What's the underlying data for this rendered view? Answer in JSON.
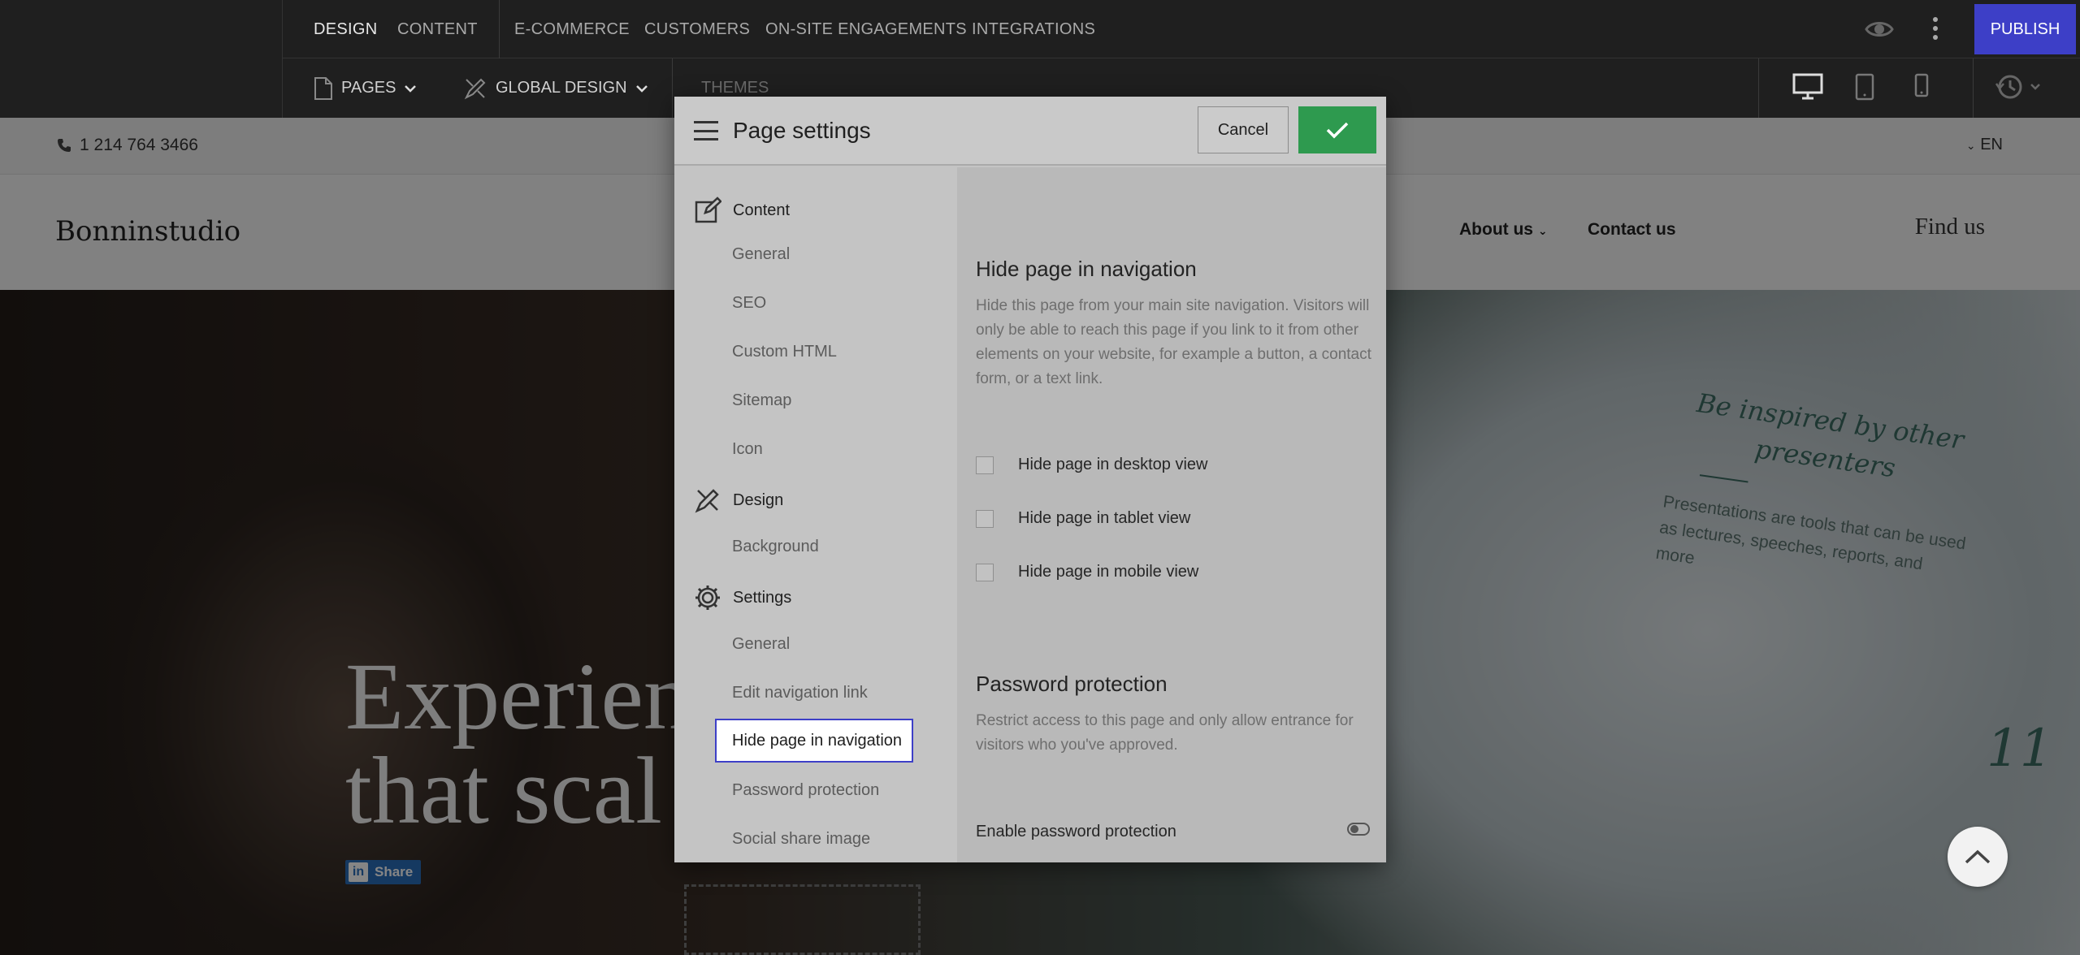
{
  "editor": {
    "tabs": [
      "DESIGN",
      "CONTENT",
      "E-COMMERCE",
      "CUSTOMERS",
      "ON-SITE ENGAGEMENTS",
      "INTEGRATIONS"
    ],
    "publish_label": "PUBLISH",
    "pages_label": "PAGES",
    "global_design_label": "GLOBAL DESIGN",
    "themes_label": "THEMES"
  },
  "site": {
    "phone": "1 214 764 3466",
    "language": "EN",
    "logo": "Bonninstudio",
    "nav": [
      "About us",
      "Contact us"
    ],
    "find_us": "Find us",
    "hero_line1": "Experien",
    "hero_line2": "that scal",
    "share_label": "Share",
    "promo_title": "Be inspired by other presenters",
    "promo_body": "Presentations are tools that can be used as lectures, speeches, reports, and more",
    "promo_number": "11"
  },
  "dialog": {
    "title": "Page settings",
    "cancel_label": "Cancel",
    "sidebar": {
      "content": {
        "label": "Content",
        "items": [
          "General",
          "SEO",
          "Custom HTML",
          "Sitemap",
          "Icon"
        ]
      },
      "design": {
        "label": "Design",
        "items": [
          "Background"
        ]
      },
      "settings": {
        "label": "Settings",
        "items": [
          "General",
          "Edit navigation link",
          "Hide page in navigation",
          "Password protection",
          "Social share image"
        ]
      }
    },
    "hide_nav": {
      "heading": "Hide page in navigation",
      "description": "Hide this page from your main site navigation. Visitors will only be able to reach this page if you link to it from other elements on your website, for example a button, a contact form, or a text link.",
      "options": [
        "Hide page in desktop view",
        "Hide page in tablet view",
        "Hide page in mobile view"
      ]
    },
    "password": {
      "heading": "Password protection",
      "description": "Restrict access to this page and only allow entrance for visitors who you've approved.",
      "toggle_label": "Enable password protection",
      "toggle_on": false
    }
  },
  "colors": {
    "accent": "#3d3fc7",
    "confirm": "#2e9a4f",
    "topbar": "#1f1f1f"
  }
}
